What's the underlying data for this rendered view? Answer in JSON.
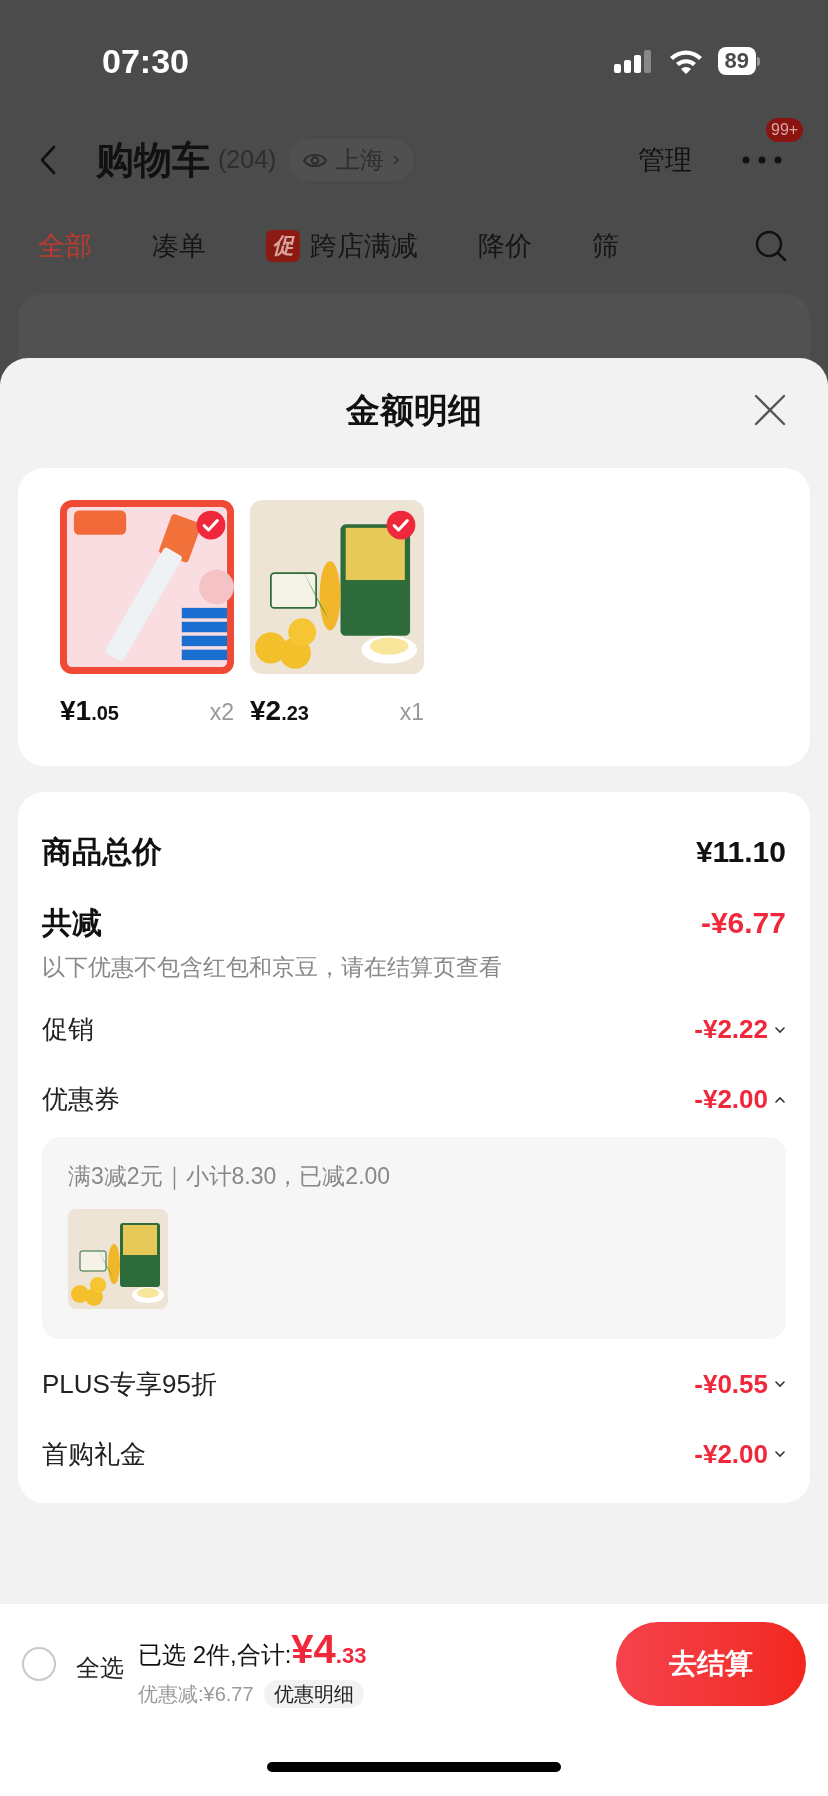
{
  "status_bar": {
    "time": "07:30",
    "battery": "89"
  },
  "header": {
    "title": "购物车",
    "count": "(204)",
    "location": "上海",
    "manage": "管理",
    "badge": "99+"
  },
  "tabs": [
    {
      "label": "全部",
      "selected": true
    },
    {
      "label": "凑单",
      "selected": false
    },
    {
      "label": "跨店满减",
      "selected": false,
      "tag": "促"
    },
    {
      "label": "降价",
      "selected": false
    },
    {
      "label": "筛",
      "selected": false
    }
  ],
  "sheet": {
    "title": "金额明细",
    "products": [
      {
        "price": "¥1.05",
        "qty": "x2",
        "selected": true
      },
      {
        "price": "¥2.23",
        "qty": "x1",
        "selected": true
      }
    ],
    "rows": [
      {
        "kind": "total",
        "label": "商品总价",
        "amount": "¥11.10"
      },
      {
        "kind": "reduction",
        "label": "共减",
        "amount": "-¥6.77",
        "note": "以下优惠不包含红包和京豆，请在结算页查看"
      },
      {
        "kind": "discount",
        "label": "促销",
        "amount": "-¥2.22",
        "expanded": false
      },
      {
        "kind": "discount",
        "label": "优惠券",
        "amount": "-¥2.00",
        "expanded": true,
        "detail": {
          "text": "满3减2元｜小计8.30，已减2.00"
        }
      },
      {
        "kind": "discount",
        "label": "PLUS专享95折",
        "amount": "-¥0.55",
        "expanded": false
      },
      {
        "kind": "discount",
        "label": "首购礼金",
        "amount": "-¥2.00",
        "expanded": false
      }
    ]
  },
  "bottom_bar": {
    "select_all": {
      "label": "全选",
      "checked": false
    },
    "summary": "已选 2件,合计:",
    "total": "¥4.33",
    "saved": "优惠减:¥6.77",
    "detail_chip": "优惠明细",
    "checkout": "去结算"
  }
}
